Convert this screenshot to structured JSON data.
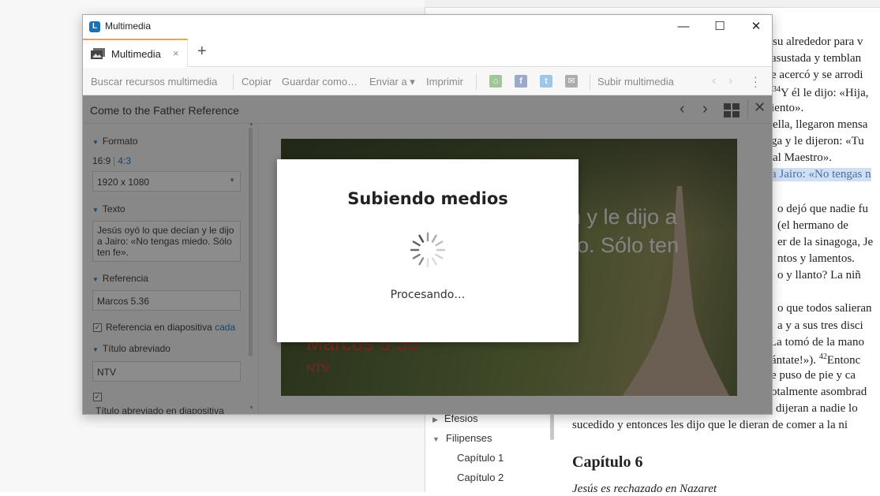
{
  "window": {
    "title": "Multimedia",
    "controls": {
      "minimize": "—",
      "maximize": "☐",
      "close": "✕"
    }
  },
  "tabs": [
    {
      "label": "Multimedia",
      "close": "×"
    }
  ],
  "tab_add": "+",
  "toolbar": {
    "search": "Buscar recursos multimedia",
    "copy": "Copiar",
    "save_as": "Guardar como…",
    "send_to": "Enviar a ▾",
    "print": "Imprimir",
    "upload": "Subir multimedia",
    "share_icons": [
      "home-share-icon",
      "facebook-icon",
      "twitter-icon",
      "email-icon"
    ]
  },
  "panel": {
    "title": "Come to the Father Reference",
    "sections": {
      "format": "Formato",
      "ratio_16_9": "16:9",
      "ratio_4_3": "4:3",
      "resolution": "1920 x 1080",
      "text": "Texto",
      "text_value": "Jesús oyó lo que decían y le dijo a Jairo: «No tengas miedo. Sólo ten fe».",
      "reference": "Referencia",
      "reference_value": "Marcos 5.36",
      "reference_on_slide": "Referencia en diapositiva",
      "reference_on_slide_link": "cada",
      "short_title": "Título abreviado",
      "short_title_value": "NTV",
      "short_title_on_slide": "Título abreviado en diapositiva"
    }
  },
  "slide": {
    "line1": "n y le dijo a",
    "line2": "o. Sólo ten",
    "reference": "Marcos 5.36",
    "version": "NTV"
  },
  "modal": {
    "title": "Subiendo medios",
    "status": "Procesando…"
  },
  "background": {
    "tree": [
      {
        "label": "Efesios",
        "arrow": "▶"
      },
      {
        "label": "Filipenses",
        "arrow": "▼"
      },
      {
        "label": "Capítulo 1"
      },
      {
        "label": "Capítulo 2"
      }
    ],
    "bible_lines": [
      "su alrededor para v",
      "asustada y temblan",
      "e acercó y se arrodi",
      "Y él le dijo: «Hija,",
      "iento».",
      "ella, llegaron mensa",
      "ga y le dijeron: «Tu",
      "al Maestro».",
      "a Jairo: «No tengas n",
      "o dejó que nadie fu",
      "(el hermano de",
      "er de la sinagoga, Je",
      "ntos y lamentos.",
      "o y llanto? La niñ",
      "o que todos salieran",
      "a y a sus tres disci",
      "La tomó de la mano",
      "ántate!»). ",
      "e puso de pie y ca",
      "otalmente asombrad",
      "dijeran a nadie lo",
      "sucedido y entonces les dijo que le dieran de comer a la ni"
    ],
    "verse_34": "34",
    "verse_42": "42",
    "verse_42_text": "Entonc",
    "chapter": "Capítulo 6",
    "subtitle": "Jesús es rechazado en Nazaret"
  }
}
